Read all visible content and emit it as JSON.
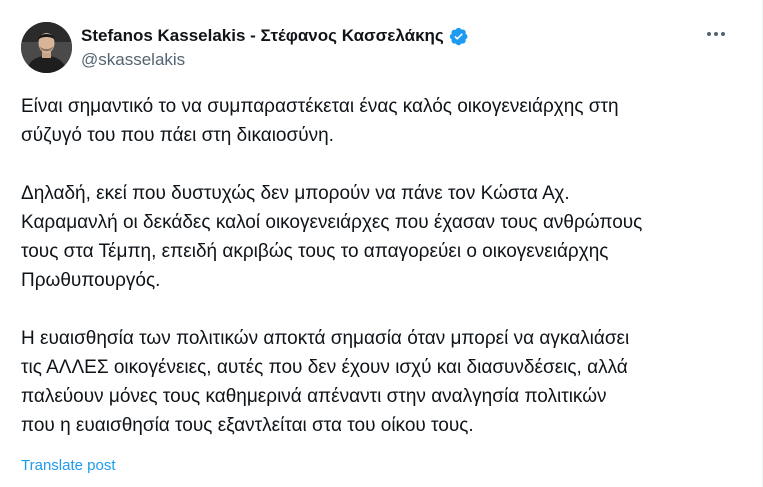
{
  "author": {
    "display_name": "Stefanos Kasselakis - Στέφανος Κασσελάκης",
    "handle": "@skasselakis",
    "verified": true,
    "verified_color": "#1d9bf0"
  },
  "icons": {
    "avatar": "profile-photo",
    "verified": "verified-badge-icon",
    "more": "more-horizontal-icon"
  },
  "tweet": {
    "paragraphs": [
      "Είναι σημαντικό το να συμπαραστέκεται ένας καλός οικογενειάρχης στη\nσύζυγό του που πάει στη δικαιοσύνη.",
      "Δηλαδή, εκεί που δυστυχώς δεν μπορούν να πάνε τον Κώστα Αχ.\nΚαραμανλή οι δεκάδες καλοί οικογενειάρχες που έχασαν τους ανθρώπους\nτους στα Τέμπη, επειδή ακριβώς τους το απαγορεύει ο οικογενειάρχης\nΠρωθυπουργός.",
      "Η ευαισθησία των πολιτικών αποκτά σημασία όταν μπορεί να αγκαλιάσει\nτις ΑΛΛΕΣ οικογένειες, αυτές που δεν έχουν ισχύ και διασυνδέσεις, αλλά\nπαλεύουν μόνες τους καθημερινά απέναντι στην αναλγησία πολιτικών\nπου η ευαισθησία τους εξαντλείται στα του οίκου τους."
    ],
    "translate_label": "Translate post"
  },
  "colors": {
    "text": "#0f1419",
    "secondary": "#536471",
    "link": "#1d9bf0"
  }
}
